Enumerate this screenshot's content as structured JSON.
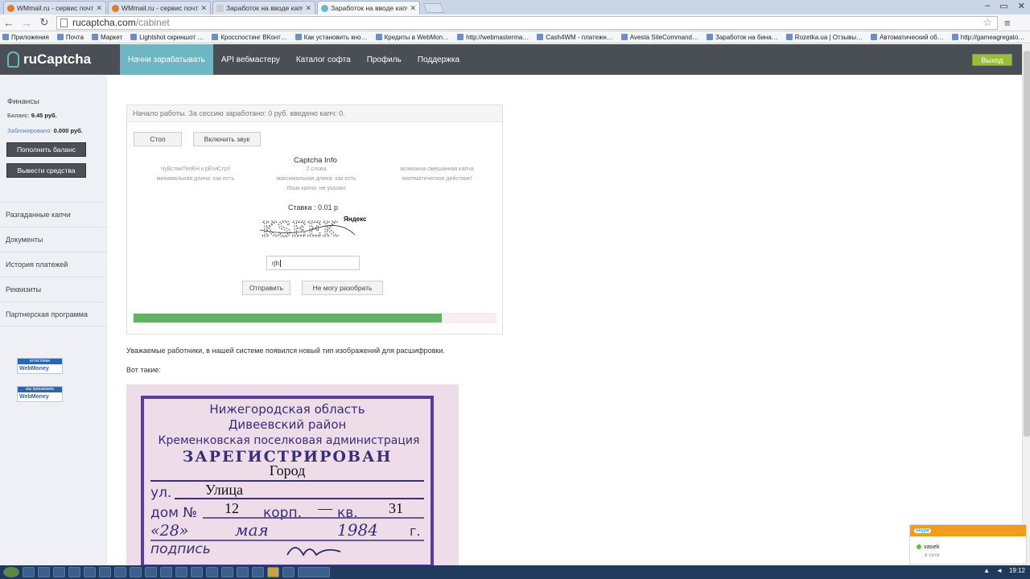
{
  "browser": {
    "tabs": [
      {
        "label": "WMmail.ru - сервис почто…"
      },
      {
        "label": "WMmail.ru - сервис почто…"
      },
      {
        "label": "Заработок на вводе капч…"
      },
      {
        "label": "Заработок на вводе капч…"
      }
    ],
    "url_host": "rucaptcha.com",
    "url_path": "/cabinet",
    "bookmarks": [
      "Приложения",
      "Почта",
      "Маркет",
      "Lightshot скриншот …",
      "Кросспостинг ВКонт…",
      "Как установить кно…",
      "Кредиты в WebMon…",
      "http://webmasterma…",
      "Cash4WM - платежн…",
      "Avesta SiteCommand…",
      "Заработок на бина…",
      "Rozetka.ua | Отзывы…",
      "Автоматический об…",
      "http://gameagregato…"
    ]
  },
  "header": {
    "logo": "ruCaptcha",
    "nav": [
      {
        "label": "Начни зарабатывать",
        "active": true
      },
      {
        "label": "API вебмастеру"
      },
      {
        "label": "Каталог софта"
      },
      {
        "label": "Профиль"
      },
      {
        "label": "Поддержка"
      }
    ],
    "logout": "Выход"
  },
  "sidebar": {
    "finance_title": "Финансы",
    "balance_label": "Баланс: ",
    "balance_value": "9.45 руб.",
    "blocked_label": "Заблокировано: ",
    "blocked_value": "0.000 руб.",
    "topup": "Пополнить баланс",
    "withdraw": "Вывести средства",
    "items": [
      "Разгаданные капчи",
      "Документы",
      "История платежей",
      "Реквизиты",
      "Партнерская программа"
    ],
    "badges": [
      {
        "top": "аттестован",
        "bottom": "WebMoney"
      },
      {
        "top": "мы принимаем",
        "bottom": "WebMoney"
      }
    ]
  },
  "work": {
    "status": "Начало работы. За сессию заработано: 0 руб. введено капч: 0.",
    "stop": "Стоп",
    "sound": "Включить звук",
    "info_title": "Captcha Info",
    "info_left": [
      "ЧуВствиТелЕН к рЕгиСтрУ",
      "минимальная длина: как есть"
    ],
    "info_center": [
      "2 слова",
      "максимальная длина: как есть",
      "Язык капчи: не указан!"
    ],
    "info_right": [
      "возможна смешанная капча",
      "математическое действие!"
    ],
    "rate": "Ставка : 0.01 р",
    "captcha_brand": "Яндекс",
    "captcha_text": "KSEEK",
    "answer": "rjh",
    "submit": "Отправить",
    "cant_solve": "Не могу разобрать",
    "progress": 0.85
  },
  "content": {
    "message": "Уважаемые работники, в нашей системе появился новый тип изображений для расшифровки.",
    "examples": "Вот такие:",
    "stamp": {
      "line1": "Нижегородская область",
      "line2": "Дивеевский район",
      "line3": "Кременковская поселковая администрация",
      "line4": "ЗАРЕГИСТРИРОВАН",
      "city": "Город",
      "street_label": "ул.",
      "street": "Улица",
      "house_label": "дом №",
      "house": "12",
      "korp_label": "корп.",
      "korp": "—",
      "kv_label": "кв.",
      "kv": "31",
      "date_day": "«28»",
      "date_month": "мая",
      "date_year": "1984",
      "date_suffix": "г.",
      "sign_label": "подпись"
    }
  },
  "skype": {
    "brand": "skype",
    "user": "vasek",
    "status": "в сети"
  },
  "taskbar": {
    "clock": "19:12"
  },
  "colors": {
    "header": "#4a4f55",
    "accent": "#6cb7c2",
    "logout": "#9bbd3c",
    "progress": "#64b064"
  }
}
